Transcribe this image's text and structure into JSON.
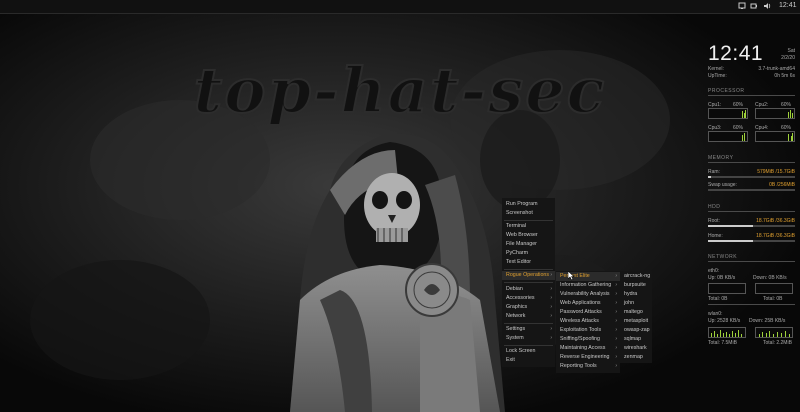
{
  "topbar": {
    "volume_icon": "speaker-icon",
    "clock": "12:41"
  },
  "wallpaper": {
    "banner_text": "top-hat-sec",
    "figure": "hooded-skull-figure"
  },
  "conky": {
    "time": "12:41",
    "day": "Sat",
    "date": "2/2/20",
    "kernel_label": "Kernel:",
    "kernel_value": "3.7-trunk-amd64",
    "uptime_label": "UpTime:",
    "uptime_value": "0h 5m 6s",
    "processor_heading": "PROCESSOR",
    "cpus": [
      {
        "label": "Cpu1:",
        "value": "60%"
      },
      {
        "label": "Cpu2:",
        "value": "60%"
      },
      {
        "label": "Cpu3:",
        "value": "60%"
      },
      {
        "label": "Cpu4:",
        "value": "60%"
      }
    ],
    "memory_heading": "MEMORY",
    "ram_label": "Ram:",
    "ram_value": "579MiB /15.7GiB",
    "ram_fraction": 0.04,
    "swap_label": "Swap usage:",
    "swap_value": "0B /256MiB",
    "swap_fraction": 0.0,
    "hdd_heading": "HDD",
    "root_label": "Root:",
    "root_value": "18.7GiB /36.3GiB",
    "root_fraction": 0.52,
    "home_label": "Home:",
    "home_value": "18.7GiB /36.3GiB",
    "home_fraction": 0.52,
    "network_heading": "NETWORK",
    "eth0_label": "eth0:",
    "eth0_up": "Up: 0B   KB/s",
    "eth0_down": "Down: 0B   KB/s",
    "eth0_total_up": "Total: 0B",
    "eth0_total_down": "Total: 0B",
    "wlan0_label": "wlan0:",
    "wlan0_up": "Up: 2528   KB/s",
    "wlan0_down": "Down: 25B   KB/s",
    "wlan0_total_up": "Total: 7.5MiB",
    "wlan0_total_down": "Total: 2.2MiB",
    "accent_green": "#9fd23a",
    "accent_orange": "#e0a030"
  },
  "menu_main": {
    "items": [
      {
        "label": "Run Program"
      },
      {
        "label": "Screenshot"
      },
      {
        "label": "Terminal"
      },
      {
        "label": "Web Browser"
      },
      {
        "label": "File Manager"
      },
      {
        "label": "PyCharm"
      },
      {
        "label": "Text Editor"
      },
      {
        "label": "Rogue Operations"
      },
      {
        "label": "Debian"
      },
      {
        "label": "Accessories"
      },
      {
        "label": "Graphics"
      },
      {
        "label": "Network"
      },
      {
        "label": "Settings"
      },
      {
        "label": "System"
      },
      {
        "label": "Lock Screen"
      },
      {
        "label": "Exit"
      }
    ]
  },
  "menu_sub": {
    "items": [
      {
        "label": "Pentest Elite"
      },
      {
        "label": "Information Gathering"
      },
      {
        "label": "Vulnerability Analysis"
      },
      {
        "label": "Web Applications"
      },
      {
        "label": "Password Attacks"
      },
      {
        "label": "Wireless Attacks"
      },
      {
        "label": "Exploitation Tools"
      },
      {
        "label": "Sniffing/Spoofing"
      },
      {
        "label": "Maintaining Access"
      },
      {
        "label": "Reverse Engineering"
      },
      {
        "label": "Reporting Tools"
      }
    ]
  },
  "menu_tools": {
    "items": [
      {
        "label": "aircrack-ng"
      },
      {
        "label": "burpsuite"
      },
      {
        "label": "hydra"
      },
      {
        "label": "john"
      },
      {
        "label": "maltego"
      },
      {
        "label": "metasploit"
      },
      {
        "label": "owasp-zap"
      },
      {
        "label": "sqlmap"
      },
      {
        "label": "wireshark"
      },
      {
        "label": "zenmap"
      }
    ]
  }
}
